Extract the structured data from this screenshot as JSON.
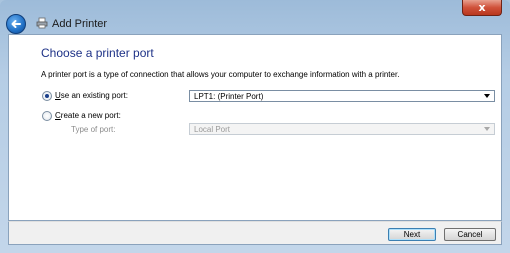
{
  "window": {
    "title": "Add Printer",
    "close_glyph": "x"
  },
  "main": {
    "heading": "Choose a printer port",
    "description": "A printer port is a type of connection that allows your computer to exchange information with a printer.",
    "options": {
      "existing": {
        "prefix": "U",
        "rest": "se an existing port:",
        "selected": true,
        "value": "LPT1: (Printer Port)"
      },
      "new": {
        "prefix": "C",
        "rest": "reate a new port:",
        "selected": false,
        "type_label": "Type of port:",
        "type_value": "Local Port"
      }
    }
  },
  "footer": {
    "next_label": "Next",
    "cancel_label": "Cancel"
  },
  "colors": {
    "heading": "#1e3287",
    "frame": "#b5cde5",
    "close": "#d0513a"
  },
  "icons": [
    "back-arrow-icon",
    "printer-icon",
    "close-icon",
    "dropdown-arrow-icon"
  ]
}
